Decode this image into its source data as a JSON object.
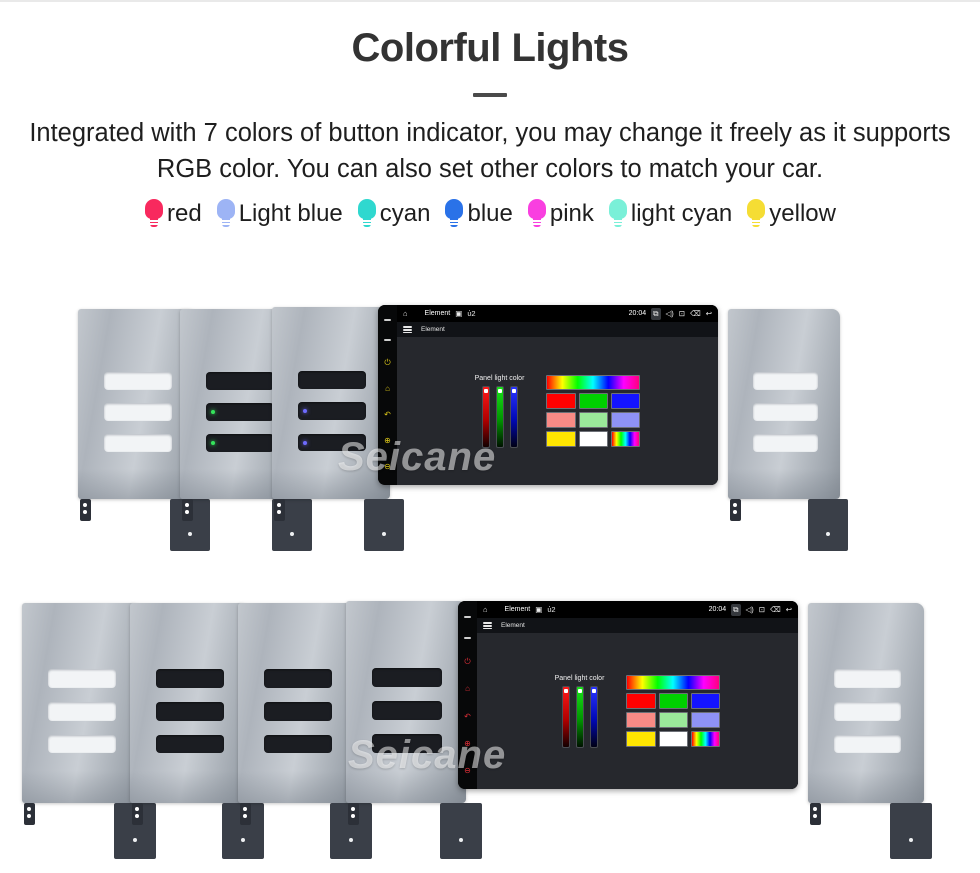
{
  "header": {
    "title": "Colorful Lights",
    "subtitle": "Integrated with 7 colors of button indicator, you may change it freely as it supports RGB color. You can also set other colors to match your car."
  },
  "legend": {
    "items": [
      {
        "label": "red",
        "color": "#f8295e"
      },
      {
        "label": "Light blue",
        "color": "#9db4f5"
      },
      {
        "label": "cyan",
        "color": "#2fd8cf"
      },
      {
        "label": "blue",
        "color": "#2a72e8"
      },
      {
        "label": "pink",
        "color": "#f93fe0"
      },
      {
        "label": "light cyan",
        "color": "#7af0d8"
      },
      {
        "label": "yellow",
        "color": "#f5dd34"
      }
    ]
  },
  "head_unit": {
    "status_bar": {
      "home_icon": "home-icon",
      "title": "Element",
      "sd_icon": "sd-card-icon",
      "lock_icon": "lock-icon",
      "time": "20:04",
      "screenshot_icon": "screenshot-icon",
      "volume_icon": "volume-icon",
      "display_icon": "display-icon",
      "link_icon": "link-icon",
      "back_icon": "back-arrow-icon"
    },
    "app_bar": {
      "menu_icon": "hamburger-menu-icon",
      "title": "Element"
    },
    "panel": {
      "sliders_title": "Panel light color",
      "sliders": [
        {
          "name": "red-slider",
          "value": 100
        },
        {
          "name": "green-slider",
          "value": 100
        },
        {
          "name": "blue-slider",
          "value": 100
        }
      ],
      "palette": {
        "hue_bar": "linear-gradient(90deg,#ff0000,#ffff00,#00ff00,#00ffff,#0000ff,#ff00ff,#ff0080)",
        "swatches": [
          {
            "name": "swatch-red",
            "color": "#ff0000"
          },
          {
            "name": "swatch-green",
            "color": "#00d000"
          },
          {
            "name": "swatch-blue",
            "color": "#1414ff"
          },
          {
            "name": "swatch-salmon",
            "color": "#f98a85"
          },
          {
            "name": "swatch-lightgreen",
            "color": "#9ae89a"
          },
          {
            "name": "swatch-periwinkle",
            "color": "#8e92f5"
          },
          {
            "name": "swatch-yellow",
            "color": "#ffe600"
          },
          {
            "name": "swatch-white",
            "color": "#ffffff"
          },
          {
            "name": "swatch-rainbow",
            "color": "rainbow"
          }
        ]
      }
    },
    "side_buttons_top": {
      "tint": "#e8d21a",
      "icons": [
        "dash-icon",
        "dash-icon",
        "power-icon",
        "home-icon",
        "back-icon",
        "volume-up-icon",
        "volume-down-icon"
      ]
    },
    "side_buttons_bottom": {
      "tint": "#e8313a",
      "icons": [
        "dash-icon",
        "dash-icon",
        "power-icon",
        "home-icon",
        "back-icon",
        "volume-up-icon",
        "volume-down-icon"
      ]
    }
  },
  "rows": {
    "top": {
      "units": [
        {
          "name": "faceplate-unit-1",
          "led": "none",
          "slots": "off"
        },
        {
          "name": "faceplate-unit-2",
          "led": "#35e35b",
          "slots": "on"
        },
        {
          "name": "faceplate-unit-3",
          "led": "#6e6bff",
          "slots": "on"
        },
        {
          "name": "faceplate-unit-4",
          "led": "none",
          "slots": "off"
        }
      ]
    },
    "bottom": {
      "units": [
        {
          "name": "faceplate-unit-5",
          "led": "none",
          "slots": "off"
        },
        {
          "name": "faceplate-unit-6",
          "led": "none",
          "slots": "on"
        },
        {
          "name": "faceplate-unit-7",
          "led": "none",
          "slots": "on"
        },
        {
          "name": "faceplate-unit-8",
          "led": "none",
          "slots": "on"
        },
        {
          "name": "faceplate-unit-9",
          "led": "none",
          "slots": "off"
        }
      ]
    }
  },
  "watermark": {
    "text": "Seicane"
  }
}
